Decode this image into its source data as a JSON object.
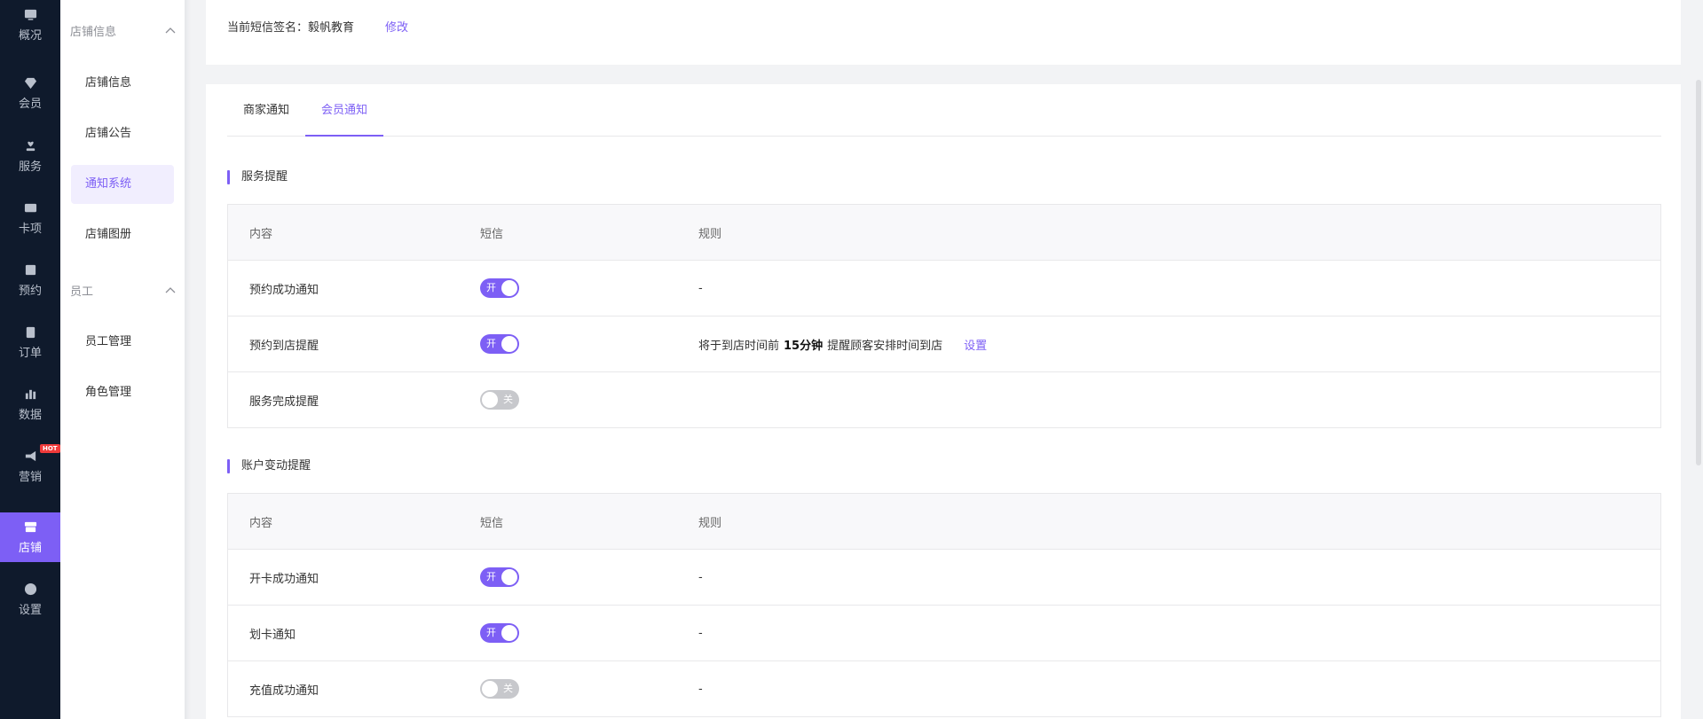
{
  "nav": {
    "items": [
      {
        "label": "概况",
        "icon": "monitor-icon"
      },
      {
        "label": "会员",
        "icon": "diamond-icon"
      },
      {
        "label": "服务",
        "icon": "heart-hand-icon"
      },
      {
        "label": "卡项",
        "icon": "card-icon"
      },
      {
        "label": "预约",
        "icon": "calendar-icon"
      },
      {
        "label": "订单",
        "icon": "clipboard-icon"
      },
      {
        "label": "数据",
        "icon": "bar-chart-icon"
      },
      {
        "label": "营销",
        "icon": "megaphone-icon",
        "badge": "HOT"
      },
      {
        "label": "店铺",
        "icon": "store-icon",
        "active": true
      },
      {
        "label": "设置",
        "icon": "gear-icon"
      }
    ]
  },
  "subnav": {
    "group1": {
      "title": "店铺信息",
      "items": [
        "店铺信息",
        "店铺公告",
        "通知系统",
        "店铺图册"
      ]
    },
    "group2": {
      "title": "员工",
      "items": [
        "员工管理",
        "角色管理"
      ]
    }
  },
  "signature": {
    "text": "当前短信签名：毅帆教育",
    "edit_label": "修改"
  },
  "tabs": [
    {
      "label": "商家通知"
    },
    {
      "label": "会员通知",
      "active": true
    }
  ],
  "sections": [
    {
      "title": "服务提醒",
      "headers": [
        "内容",
        "短信",
        "规则"
      ],
      "rows": [
        {
          "content": "预约成功通知",
          "switch": "开",
          "on": true,
          "rule": "-"
        },
        {
          "content": "预约到店提醒",
          "switch": "开",
          "on": true,
          "rule_prefix": "将于到店时间前",
          "rule_strong": "15分钟",
          "rule_suffix": "提醒顾客安排时间到店",
          "rule_link": "设置"
        },
        {
          "content": "服务完成提醒",
          "switch": "关",
          "on": false,
          "rule": ""
        }
      ]
    },
    {
      "title": "账户变动提醒",
      "headers": [
        "内容",
        "短信",
        "规则"
      ],
      "rows": [
        {
          "content": "开卡成功通知",
          "switch": "开",
          "on": true,
          "rule": "-"
        },
        {
          "content": "划卡通知",
          "switch": "开",
          "on": true,
          "rule": "-"
        },
        {
          "content": "充值成功通知",
          "switch": "关",
          "on": false,
          "rule": "-"
        }
      ]
    }
  ],
  "colors": {
    "accent": "#7d5ff5",
    "nav_bg": "#0f1a2c",
    "switch_off": "#c7c8cc"
  }
}
